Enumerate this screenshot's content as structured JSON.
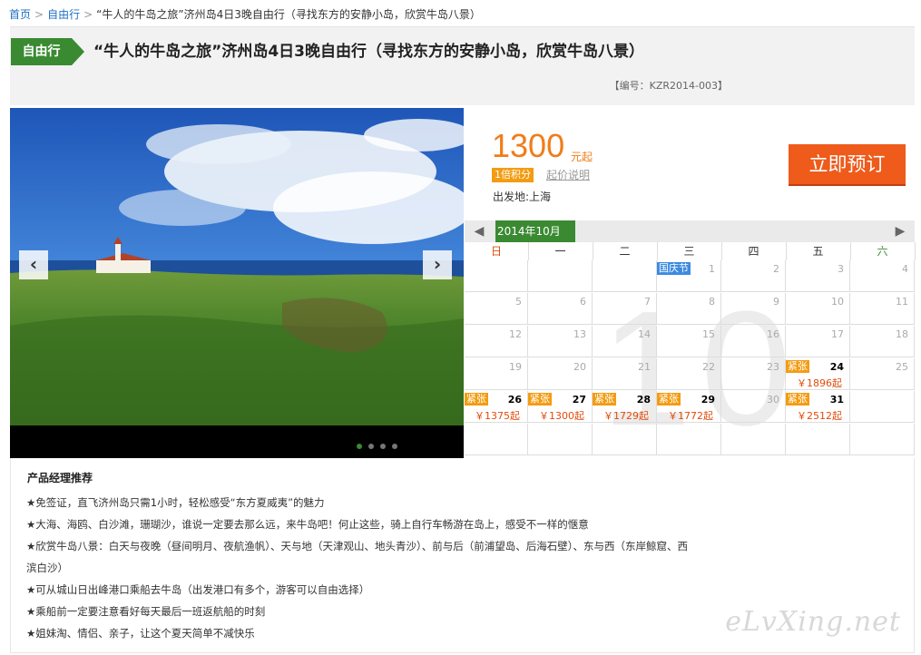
{
  "breadcrumb": {
    "home": "首页",
    "category": "自由行",
    "current": "“牛人的牛岛之旅”济州岛4日3晚自由行（寻找东方的安静小岛，欣赏牛岛八景）"
  },
  "header": {
    "tag": "自由行",
    "title": "“牛人的牛岛之旅”济州岛4日3晚自由行（寻找东方的安静小岛，欣赏牛岛八景）",
    "product_code": "【编号：KZR2014-003】"
  },
  "gallery": {
    "prev_icon": "chevron-left-icon",
    "next_icon": "chevron-right-icon",
    "slide_count": 4,
    "active_slide": 1
  },
  "pricing": {
    "price": "1300",
    "unit": "元起",
    "points": "1倍积分",
    "price_note": "起价说明",
    "departure": "出发地:上海",
    "book_button": "立即预订"
  },
  "calendar": {
    "month": "2014年10月",
    "watermark": "10",
    "weekdays": [
      "日",
      "一",
      "二",
      "三",
      "四",
      "五",
      "六"
    ],
    "first_weekday": 3,
    "days_in_month": 31,
    "total_rows": 6,
    "holiday": {
      "day": 1,
      "label": "国庆节"
    },
    "available": [
      {
        "day": 24,
        "badge": "紧张",
        "price": "￥1896起"
      },
      {
        "day": 26,
        "badge": "紧张",
        "price": "￥1375起"
      },
      {
        "day": 27,
        "badge": "紧张",
        "price": "￥1300起"
      },
      {
        "day": 28,
        "badge": "紧张",
        "price": "￥1729起"
      },
      {
        "day": 29,
        "badge": "紧张",
        "price": "￥1772起"
      },
      {
        "day": 31,
        "badge": "紧张",
        "price": "￥2512起"
      }
    ],
    "colors": {
      "accent": "#3a8a32",
      "hot": "#f39c12",
      "price": "#e14c0b"
    }
  },
  "recommend": {
    "title": "产品经理推荐",
    "items": [
      "★免签证，直飞济州岛只需1小时，轻松感受“东方夏威夷”的魅力",
      "★大海、海鸥、白沙滩，珊瑚沙，谁说一定要去那么远，来牛岛吧！何止这些，骑上自行车畅游在岛上，感受不一样的惬意",
      "★欣赏牛岛八景：白天与夜晚（昼间明月、夜航渔帆）、天与地（天津观山、地头青沙）、前与后（前浦望岛、后海石壁）、东与西（东岸鲸窟、西",
      "滨白沙）",
      "★可从城山日出峰港口乘船去牛岛（出发港口有多个，游客可以自由选择）",
      "★乘船前一定要注意看好每天最后一班返航船的时刻",
      "★姐妹淘、情侣、亲子，让这个夏天简单不减快乐"
    ],
    "watermark": "eLvXing.net"
  }
}
